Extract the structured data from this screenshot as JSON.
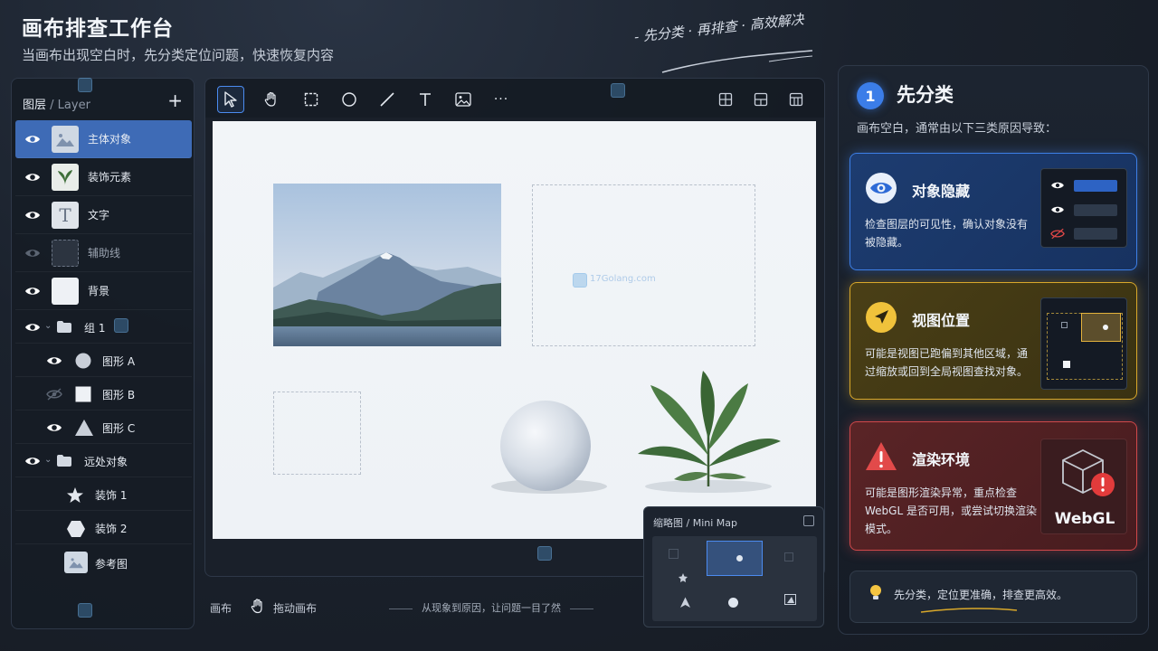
{
  "header": {
    "title": "画布排查工作台",
    "subtitle": "当画布出现空白时，先分类定位问题，快速恢复内容",
    "slogan": "- 先分类 · 再排查 · 高效解决"
  },
  "layers": {
    "title": "图层",
    "title_en": "/ Layer",
    "add_label": "+",
    "items": [
      {
        "label": "主体对象",
        "visible": true,
        "selected": true,
        "thumb": "image-icon"
      },
      {
        "label": "装饰元素",
        "visible": true,
        "thumb": "leaf-icon"
      },
      {
        "label": "文字",
        "visible": true,
        "thumb": "text-icon"
      },
      {
        "label": "辅助线",
        "visible": false,
        "thumb": "dashed-box-icon"
      },
      {
        "label": "背景",
        "visible": true,
        "thumb": "blank"
      },
      {
        "label": "组 1",
        "visible": true,
        "type": "folder"
      },
      {
        "label": "图形 A",
        "visible": true,
        "shape": "circle"
      },
      {
        "label": "图形 B",
        "visible": false,
        "shape": "square"
      },
      {
        "label": "图形 C",
        "visible": true,
        "shape": "triangle"
      },
      {
        "label": "远处对象",
        "visible": true,
        "type": "folder"
      },
      {
        "label": "装饰 1",
        "shape": "star"
      },
      {
        "label": "装饰 2",
        "shape": "hexagon"
      },
      {
        "label": "参考图",
        "thumb": "image-icon"
      }
    ]
  },
  "toolbar": {
    "tools": [
      "select-icon",
      "hand-icon",
      "rectangle-icon",
      "ellipse-icon",
      "line-icon",
      "text-icon",
      "image-icon",
      "more-icon"
    ],
    "layouts": [
      "grid-icon",
      "layout-split-icon",
      "layout-quad-icon"
    ],
    "more_label": "···"
  },
  "canvas": {
    "watermark": "17Golang.com"
  },
  "status": {
    "canvas_label": "画布",
    "drag_label": "拖动画布",
    "tagline": "从现象到原因，让问题一目了然"
  },
  "minimap": {
    "title": "缩略图 / Mini Map"
  },
  "diagnosis": {
    "step": "1",
    "title": "先分类",
    "description": "画布空白，通常由以下三类原因导致：",
    "cards": [
      {
        "title": "对象隐藏",
        "description": "检查图层的可见性，确认对象没有被隐藏。",
        "color": "#3d7fe6"
      },
      {
        "title": "视图位置",
        "description": "可能是视图已跑偏到其他区域，通过缩放或回到全局视图查找对象。",
        "color": "#d9a82a"
      },
      {
        "title": "渲染环境",
        "description": "可能是图形渲染异常，重点检查 WebGL 是否可用，或尝试切换渲染模式。",
        "color": "#d0484a",
        "badge": "WebGL"
      }
    ],
    "tip": "先分类，定位更准确，排查更高效。"
  },
  "colors": {
    "accent": "#3b7de8",
    "selected_row": "#3e6bb6",
    "warning": "#d9a82a",
    "danger": "#d0484a"
  }
}
